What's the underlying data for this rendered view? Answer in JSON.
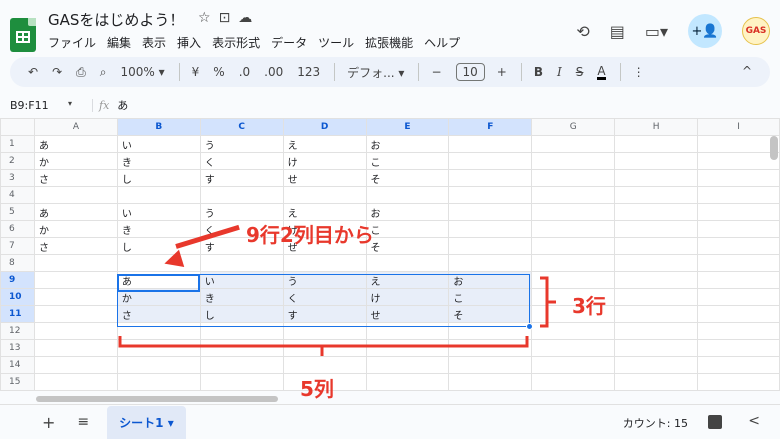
{
  "doc": {
    "title": "GASをはじめよう！",
    "star_icon": "☆",
    "move_icon": "⊡",
    "cloud_icon": "☁"
  },
  "menu": [
    "ファイル",
    "編集",
    "表示",
    "挿入",
    "表示形式",
    "データ",
    "ツール",
    "拡張機能",
    "ヘルプ"
  ],
  "top_right": {
    "history_icon": "⟲",
    "comment_icon": "▤",
    "meet_icon": "▭▾",
    "share_icon": "+👤",
    "avatar_text": "GAS"
  },
  "toolbar": {
    "undo": "↶",
    "redo": "↷",
    "print": "⎙",
    "paint_format": "⌕",
    "zoom": "100%",
    "zoom_caret": "▾",
    "currency": "¥",
    "percent": "%",
    "dec_decrease": ".0",
    "dec_increase": ".00",
    "number_format": "123",
    "font": "デフォ...",
    "font_caret": "▾",
    "size_minus": "−",
    "font_size": "10",
    "size_plus": "+",
    "bold": "B",
    "italic": "I",
    "strike": "S",
    "text_color": "A",
    "more": "⋮",
    "collapse": "^"
  },
  "formula": {
    "cell_ref": "B9:F11",
    "caret": "▾",
    "fx": "fx",
    "value": "あ"
  },
  "columns": [
    "A",
    "B",
    "C",
    "D",
    "E",
    "F",
    "G",
    "H",
    "I"
  ],
  "rows": [
    {
      "num": "1",
      "cells": [
        "あ",
        "い",
        "う",
        "え",
        "お",
        "",
        "",
        "",
        ""
      ]
    },
    {
      "num": "2",
      "cells": [
        "か",
        "き",
        "く",
        "け",
        "こ",
        "",
        "",
        "",
        ""
      ]
    },
    {
      "num": "3",
      "cells": [
        "さ",
        "し",
        "す",
        "せ",
        "そ",
        "",
        "",
        "",
        ""
      ]
    },
    {
      "num": "4",
      "cells": [
        "",
        "",
        "",
        "",
        "",
        "",
        "",
        "",
        ""
      ]
    },
    {
      "num": "5",
      "cells": [
        "あ",
        "い",
        "う",
        "え",
        "お",
        "",
        "",
        "",
        ""
      ]
    },
    {
      "num": "6",
      "cells": [
        "か",
        "き",
        "く",
        "け",
        "こ",
        "",
        "",
        "",
        ""
      ]
    },
    {
      "num": "7",
      "cells": [
        "さ",
        "し",
        "す",
        "せ",
        "そ",
        "",
        "",
        "",
        ""
      ]
    },
    {
      "num": "8",
      "cells": [
        "",
        "",
        "",
        "",
        "",
        "",
        "",
        "",
        ""
      ]
    },
    {
      "num": "9",
      "cells": [
        "",
        "あ",
        "い",
        "う",
        "え",
        "お",
        "",
        "",
        ""
      ]
    },
    {
      "num": "10",
      "cells": [
        "",
        "か",
        "き",
        "く",
        "け",
        "こ",
        "",
        "",
        ""
      ]
    },
    {
      "num": "11",
      "cells": [
        "",
        "さ",
        "し",
        "す",
        "せ",
        "そ",
        "",
        "",
        ""
      ]
    },
    {
      "num": "12",
      "cells": [
        "",
        "",
        "",
        "",
        "",
        "",
        "",
        "",
        ""
      ]
    },
    {
      "num": "13",
      "cells": [
        "",
        "",
        "",
        "",
        "",
        "",
        "",
        "",
        ""
      ]
    },
    {
      "num": "14",
      "cells": [
        "",
        "",
        "",
        "",
        "",
        "",
        "",
        "",
        ""
      ]
    },
    {
      "num": "15",
      "cells": [
        "",
        "",
        "",
        "",
        "",
        "",
        "",
        "",
        ""
      ]
    }
  ],
  "annotations": {
    "start_label": "9行2列目から",
    "rows_label": "3行",
    "cols_label": "5列",
    "color": "#e8382c"
  },
  "bottom": {
    "add_sheet": "+",
    "all_sheets": "≡",
    "sheet_name": "シート1",
    "sheet_caret": "▾",
    "count": "カウント: 15",
    "collapse_side": "<"
  },
  "colors": {
    "selection_border": "#1a73e8",
    "header_selected": "#d3e3fd",
    "cell_selected": "#e8eef9",
    "brand_green": "#1e8e3e"
  }
}
